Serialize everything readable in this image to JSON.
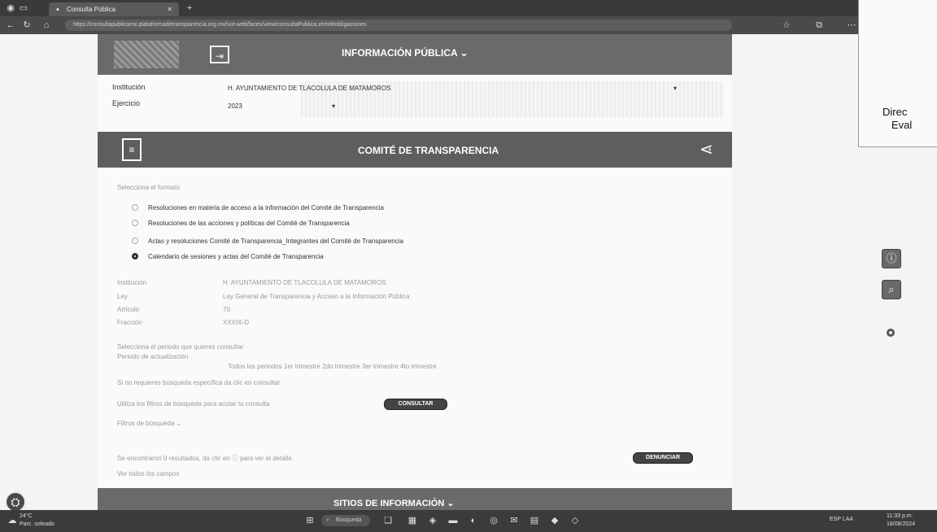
{
  "browser": {
    "tab_title": "Consulta Pública",
    "url": "https://consultapublicamx.plataformadetransparencia.org.mx/vut-web/faces/view/consultaPublica.xhtml#obligaciones"
  },
  "topbar": {
    "title": "INFORMACIÓN PÚBLICA ⌄"
  },
  "filters": {
    "institucion_label": "Institución",
    "institucion_value": "H. AYUNTAMIENTO DE TLACOLULA DE MATAMOROS",
    "ejercicio_label": "Ejercicio",
    "ejercicio_value": "2023"
  },
  "section": {
    "title": "COMITÉ DE TRANSPARENCIA"
  },
  "formats": {
    "prompt": "Selecciona el formato",
    "options": [
      {
        "label": "Resoluciones en materia de acceso a la información del Comité de Transparencia",
        "selected": false
      },
      {
        "label": "Resoluciones de las acciones y políticas del Comité de Transparencia",
        "selected": false
      },
      {
        "label": "Actas y resoluciones Comité de Transparencia_Integrantes del Comité de Transparencia",
        "selected": false
      },
      {
        "label": "Calendario de sesiones y actas del Comité de Transparencia",
        "selected": true
      }
    ]
  },
  "details": {
    "institucion_label": "Institución",
    "institucion_value": "H. AYUNTAMIENTO DE TLACOLULA DE MATAMOROS",
    "ley_label": "Ley",
    "ley_value": "Ley General de Transparencia y Acceso a la Información Pública",
    "articulo_label": "Artículo",
    "articulo_value": "70",
    "fraccion_label": "Fracción",
    "fraccion_value": "XXXIX-D"
  },
  "period": {
    "prompt": "Selecciona el periodo que quieres consultar",
    "label": "Periodo de actualización",
    "options": "Todos los periodos    1er trimestre    2do trimestre    3er trimestre    4to trimestre"
  },
  "query": {
    "hint": "Si no requieres búsqueda específica da clic en consultar",
    "filters_hint": "Utiliza los filtros de búsqueda para acotar tu consulta",
    "consultar_label": "CONSULTAR",
    "filtros_label": "Filtros de búsqueda ⌄"
  },
  "results": {
    "text": "Se encontraron 0 resultados, da clic en ⓘ para ver el detalle.",
    "denunciar_label": "DENUNCIAR",
    "ver_todos": "Ver todos los campos"
  },
  "bottombar": {
    "title": "SITIOS DE INFORMACIÓN ⌄"
  },
  "paper": {
    "line1": "Direc",
    "line2": "Eval"
  },
  "taskbar": {
    "weather": "24°C",
    "weather_desc": "Parc. soleado",
    "search_placeholder": "Búsqueda",
    "lang": "ESP LAA",
    "time": "11:33 p.m.",
    "date": "18/08/2024"
  }
}
